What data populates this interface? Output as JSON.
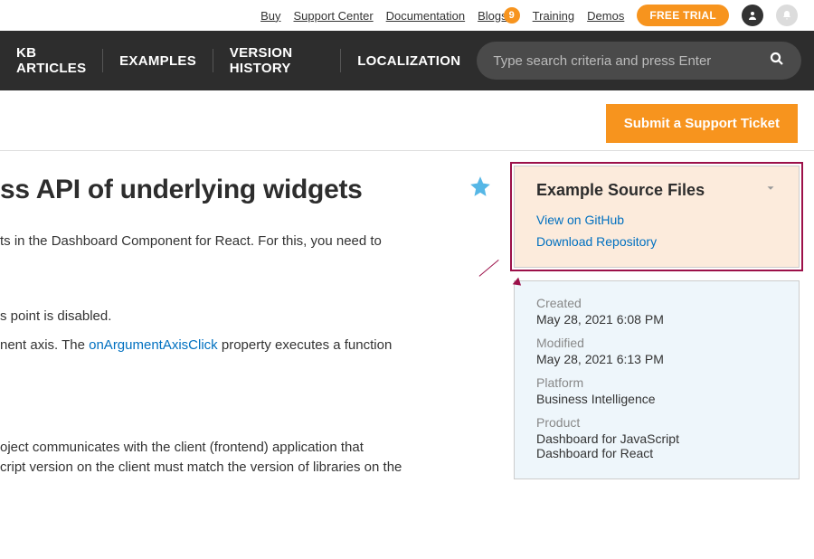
{
  "topbar": {
    "links": [
      "Buy",
      "Support Center",
      "Documentation",
      "Blogs",
      "Training",
      "Demos"
    ],
    "blog_badge": "9",
    "free_trial": "FREE TRIAL"
  },
  "nav": {
    "tabs": [
      "KB ARTICLES",
      "EXAMPLES",
      "VERSION HISTORY",
      "LOCALIZATION"
    ],
    "search_placeholder": "Type search criteria and press Enter"
  },
  "subhead": {
    "submit_label": "Submit a Support Ticket"
  },
  "page": {
    "title": "ss API of underlying widgets",
    "para1": "ts in the Dashboard Component for React. For this, you need to",
    "para2a": "s point is disabled.",
    "para2b_pre": "nent axis. The ",
    "para2b_link": "onArgumentAxisClick",
    "para2b_post": " property executes a function",
    "para3a": "oject communicates with the client (frontend) application that",
    "para3b": "cript version on the client must match the version of libraries on the"
  },
  "source_panel": {
    "title": "Example Source Files",
    "links": [
      "View on GitHub",
      "Download Repository"
    ]
  },
  "meta_panel": {
    "created_label": "Created",
    "created_value": "May 28, 2021 6:08 PM",
    "modified_label": "Modified",
    "modified_value": "May 28, 2021 6:13 PM",
    "platform_label": "Platform",
    "platform_value": "Business Intelligence",
    "product_label": "Product",
    "product_values": [
      "Dashboard for JavaScript",
      "Dashboard for React"
    ]
  }
}
